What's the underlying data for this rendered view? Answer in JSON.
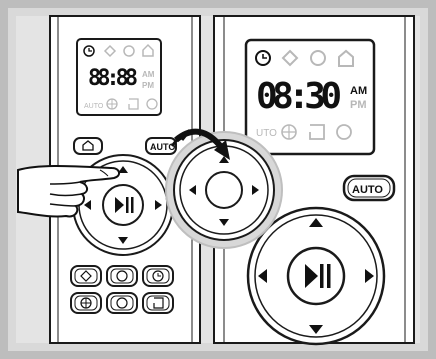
{
  "left_remote": {
    "display": {
      "time": "88:88",
      "am": "AM",
      "pm": "PM",
      "auto": "AUTO",
      "icons": [
        "clock-icon",
        "spot-clean-icon",
        "edge-clean-icon",
        "home-icon",
        "navigate-icon",
        "room-icon",
        "zone-icon"
      ]
    },
    "home_button_icon": "home-icon",
    "auto_button_label": "AUTO",
    "play_pause_icon": "play-pause-icon",
    "mode_buttons_row1": [
      "spot-clean-icon",
      "edge-clean-icon",
      "clock-icon"
    ],
    "mode_buttons_row2": [
      "navigate-icon",
      "zone-icon",
      "room-icon"
    ]
  },
  "right_remote": {
    "display": {
      "time": "08:30",
      "am": "AM",
      "pm": "PM",
      "auto": "UTO",
      "icons": [
        "clock-icon",
        "spot-clean-icon",
        "edge-clean-icon",
        "home-icon",
        "navigate-icon",
        "room-icon",
        "zone-icon"
      ]
    },
    "auto_button_label": "AUTO",
    "play_pause_icon": "play-pause-icon"
  },
  "colors": {
    "background": "#d9d9d9",
    "remote_body": "#ffffff",
    "outline": "#1a1a1a",
    "dim_icon": "#b8b8b8",
    "arrow": "#111111"
  }
}
